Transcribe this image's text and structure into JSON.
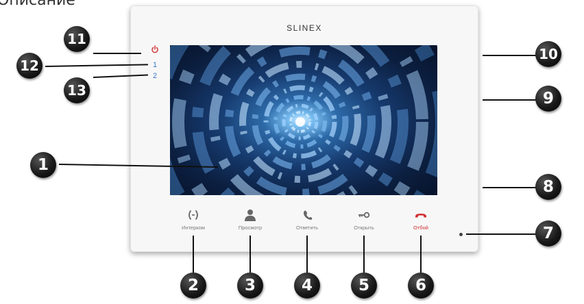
{
  "page": {
    "title": "Описание"
  },
  "device": {
    "brand": "SLINEX",
    "indicators": {
      "led1": "1",
      "led2": "2"
    },
    "buttons": [
      {
        "label": "Интерком",
        "icon": "intercom-icon"
      },
      {
        "label": "Просмотр",
        "icon": "person-icon"
      },
      {
        "label": "Ответить",
        "icon": "answer-phone-icon"
      },
      {
        "label": "Открыть",
        "icon": "key-icon"
      },
      {
        "label": "Отбой",
        "icon": "hangup-icon",
        "color": "#d12d2d"
      }
    ]
  },
  "callouts": [
    "1",
    "2",
    "3",
    "4",
    "5",
    "6",
    "7",
    "8",
    "9",
    "10",
    "11",
    "12",
    "13"
  ],
  "colors": {
    "indicator": "#3e78c8",
    "power": "#d12d2d",
    "badge": "#111111"
  }
}
